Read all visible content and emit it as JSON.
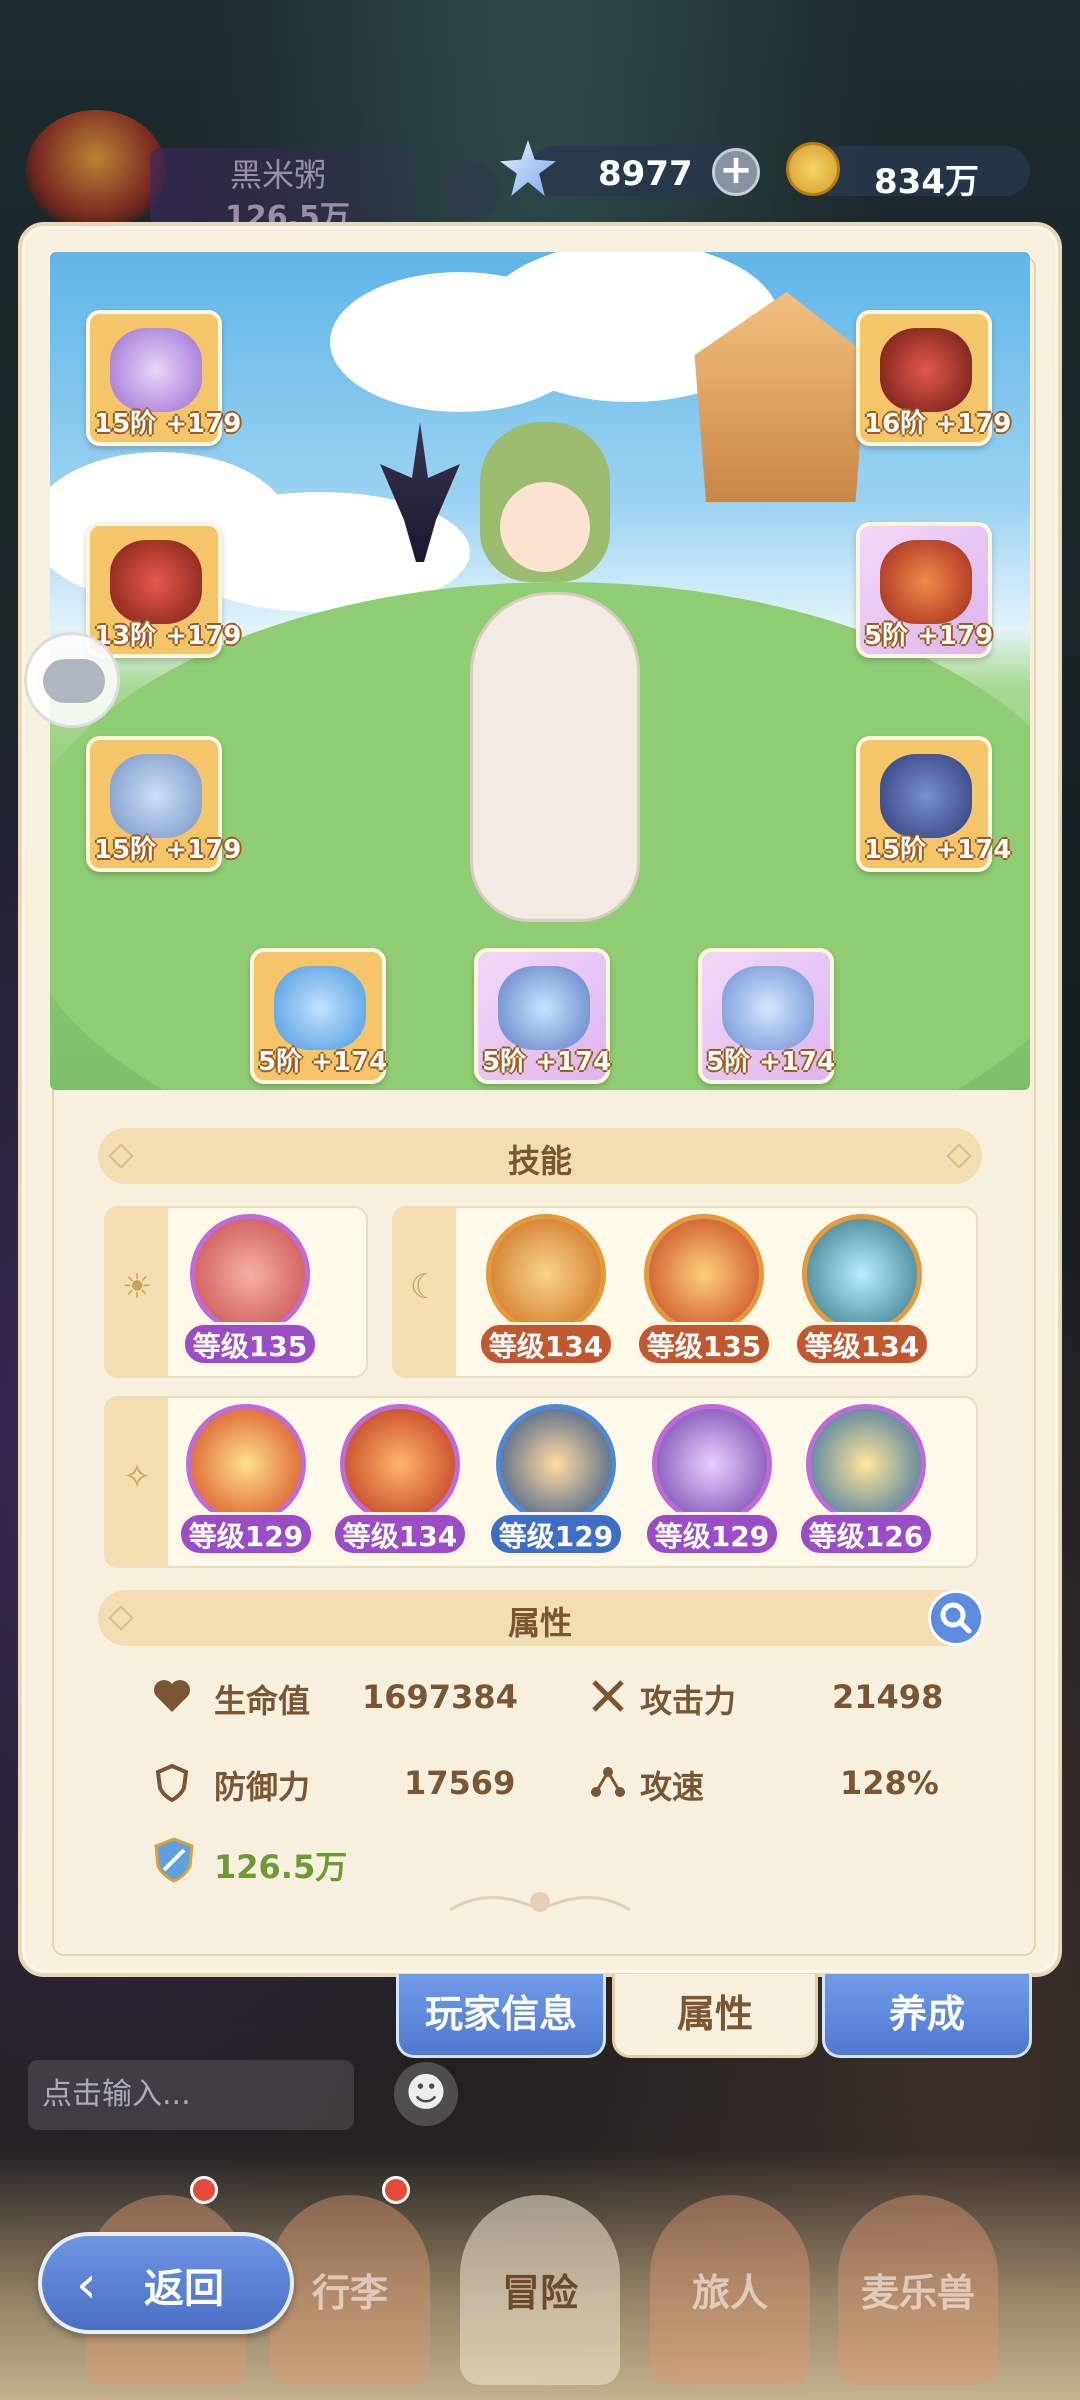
{
  "player": {
    "name": "黑米粥",
    "power": "126.5万"
  },
  "currency": {
    "gems": "8977",
    "coins": "834万"
  },
  "equipment": [
    {
      "level": "15阶 +179"
    },
    {
      "level": "13阶 +179"
    },
    {
      "level": "15阶 +179"
    },
    {
      "level": "16阶 +179"
    },
    {
      "level": "5阶 +179"
    },
    {
      "level": "15阶 +174"
    },
    {
      "level": "5阶 +174"
    },
    {
      "level": "5阶 +174"
    },
    {
      "level": "5阶 +174"
    }
  ],
  "skills": {
    "title": "技能",
    "group1": [
      {
        "level": "等级135"
      }
    ],
    "group2": [
      {
        "level": "等级134"
      },
      {
        "level": "等级135"
      },
      {
        "level": "等级134"
      }
    ],
    "group3": [
      {
        "level": "等级129"
      },
      {
        "level": "等级134"
      },
      {
        "level": "等级129"
      },
      {
        "level": "等级129"
      },
      {
        "level": "等级126"
      }
    ]
  },
  "attributes": {
    "title": "属性",
    "hp_label": "生命值",
    "hp_value": "1697384",
    "atk_label": "攻击力",
    "atk_value": "21498",
    "def_label": "防御力",
    "def_value": "17569",
    "spd_label": "攻速",
    "spd_value": "128%",
    "power_value": "126.5万"
  },
  "tabs": {
    "player_info": "玩家信息",
    "attributes": "属性",
    "cultivate": "养成"
  },
  "chat": {
    "placeholder": "点击输入...",
    "emoji": "☻"
  },
  "nav": {
    "luggage": "行李",
    "adventure": "冒险",
    "traveler": "旅人",
    "pet": "麦乐兽",
    "back": "返回"
  },
  "colors": {
    "accent_blue": "#5b8de0",
    "orange_badge": "#c0592f",
    "purple_badge": "#9b4cc7",
    "blue_badge": "#3f6ec8",
    "cream": "#f8f1df"
  }
}
